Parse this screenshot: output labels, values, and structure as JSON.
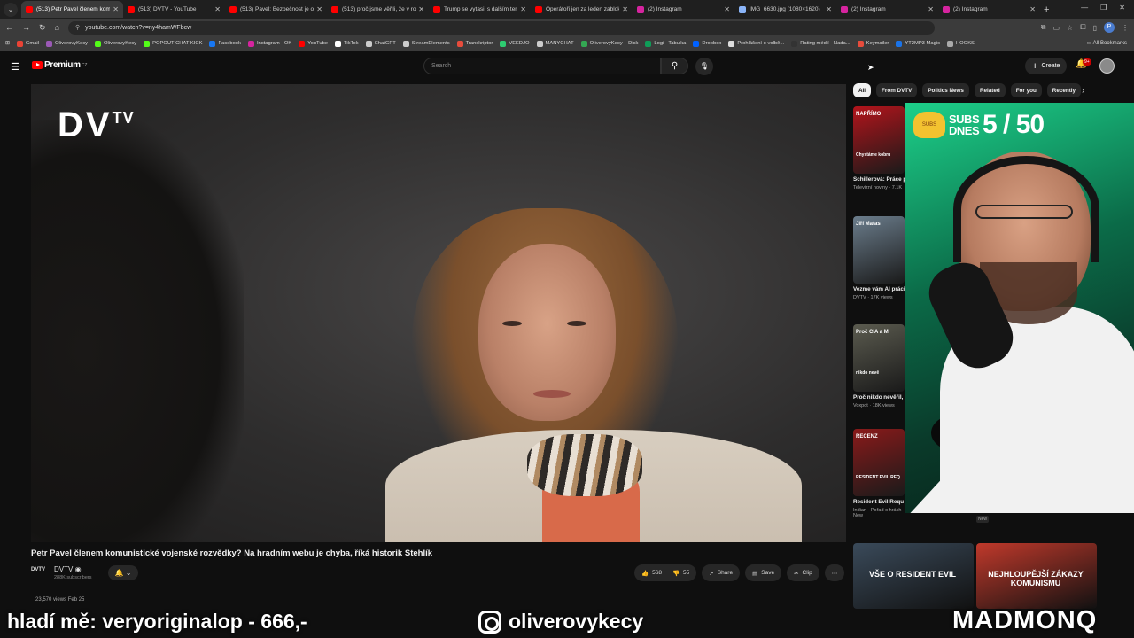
{
  "tabs": [
    {
      "title": "(513) Petr Pavel členem komu",
      "color": "#ff0000",
      "active": true
    },
    {
      "title": "(513) DVTV - YouTube",
      "color": "#ff0000"
    },
    {
      "title": "(513) Pavel: Bezpečnost je ocl",
      "color": "#ff0000"
    },
    {
      "title": "(513) proč jsme věřili, že v ro",
      "color": "#ff0000"
    },
    {
      "title": "Trump se vytasil s dalším ten",
      "color": "#ff0000"
    },
    {
      "title": "Operátoři jen za leden zablok",
      "color": "#ff0000"
    },
    {
      "title": "(2) Instagram",
      "color": "#d6249f"
    },
    {
      "title": "IMG_6630.jpg (1080×1620)",
      "color": "#8ab4f8"
    },
    {
      "title": "(2) Instagram",
      "color": "#d6249f"
    },
    {
      "title": "(2) Instagram",
      "color": "#d6249f"
    }
  ],
  "url": "youtube.com/watch?v=ny4hamWFbcw",
  "bookmarks": [
    {
      "label": "Gmail",
      "color": "#ea4335"
    },
    {
      "label": "OliverovyKecy",
      "color": "#9b59b6"
    },
    {
      "label": "OliverovyKecy",
      "color": "#53fc18"
    },
    {
      "label": "POPOUT CHAT KICK",
      "color": "#53fc18"
    },
    {
      "label": "Facebook",
      "color": "#1877f2"
    },
    {
      "label": "Instagram - OK",
      "color": "#d6249f"
    },
    {
      "label": "YouTube",
      "color": "#ff0000"
    },
    {
      "label": "TikTok",
      "color": "#ffffff"
    },
    {
      "label": "ChatGPT",
      "color": "#cccccc"
    },
    {
      "label": "StreamElements",
      "color": "#cccccc"
    },
    {
      "label": "Transkriptor",
      "color": "#e74c3c"
    },
    {
      "label": "VEEDJO",
      "color": "#2ecc71"
    },
    {
      "label": "MANYCHAT",
      "color": "#cccccc"
    },
    {
      "label": "OliverovyKecy – Disk",
      "color": "#34a853"
    },
    {
      "label": "Logi - Tabulka",
      "color": "#0f9d58"
    },
    {
      "label": "Dropbox",
      "color": "#0061ff"
    },
    {
      "label": "Prohlášení o volbě...",
      "color": "#dddddd"
    },
    {
      "label": "Rating médií - Nada...",
      "color": "#333333"
    },
    {
      "label": "Keymailer",
      "color": "#e74c3c"
    },
    {
      "label": "YT2MP3 Magic",
      "color": "#1a73e8"
    },
    {
      "label": "HOOKS",
      "color": "#aaaaaa"
    }
  ],
  "all_bookmarks": "All Bookmarks",
  "yt": {
    "logo": "Premium",
    "region": "CZ",
    "search_placeholder": "Search",
    "create": "Create",
    "notif_badge": "9+"
  },
  "video": {
    "overlay_logo": "DV",
    "overlay_logo_sup": "TV",
    "title": "Petr Pavel členem komunistické vojenské rozvědky? Na hradním webu je chyba, říká historik Stehlík",
    "channel_icon": "DVTV",
    "channel": "DVTV",
    "subscribers": "288K subscribers",
    "likes": "568",
    "dislikes": "55",
    "share": "Share",
    "save": "Save",
    "clip": "Clip",
    "meta": "23,570 views  Feb 25"
  },
  "chips": [
    "All",
    "From DVTV",
    "Politics News",
    "Related",
    "For you",
    "Recently"
  ],
  "recommendations": [
    {
      "title": "Schillerová: Práce pracovní agentury",
      "meta": "Televizní noviny · 7.1K",
      "label": "NAPŘÍMO",
      "sub": "Chystáme kobru",
      "color": "#b3141b"
    },
    {
      "title": "Vezme vám AI práci než my ve všem. A",
      "meta": "DVTV · 17K views",
      "label": "Jiří Matas",
      "sub": "",
      "color": "#6b7d8c"
    },
    {
      "title": "Proč nikdo nevěřil, napadne Ukrajinu",
      "meta": "Voxpot · 18K views",
      "label": "Proč CIA a M",
      "sub": "nikdo nevě",
      "color": "#5b5b4f"
    },
    {
      "title": "Resident Evil Requ",
      "meta": "Indian - Pořad o hrách · 22K views · 22 hours ago · New",
      "label": "RECENZ",
      "sub": "RESIDENT EVIL REQ",
      "color": "#8a1a1a"
    }
  ],
  "rec_meta_right": "Televizní noviny · 612 views · 20 hours ago",
  "rec_new": "New",
  "bottom_recs": [
    {
      "label": "VŠE O RESIDENT EVIL",
      "color": "#3a4a5a"
    },
    {
      "label": "NEJHLOUPĚJŠÍ ZÁKAZY KOMUNISMU",
      "color": "#c0392b"
    }
  ],
  "webcam": {
    "subs_label": "SUBS DNES",
    "subs_count": "5 / 50",
    "logo": "SUBS"
  },
  "banner": {
    "left": "hladí mě: veryoriginalop - 666,-",
    "middle": "oliverovykecy",
    "right": "MADMONQ"
  }
}
